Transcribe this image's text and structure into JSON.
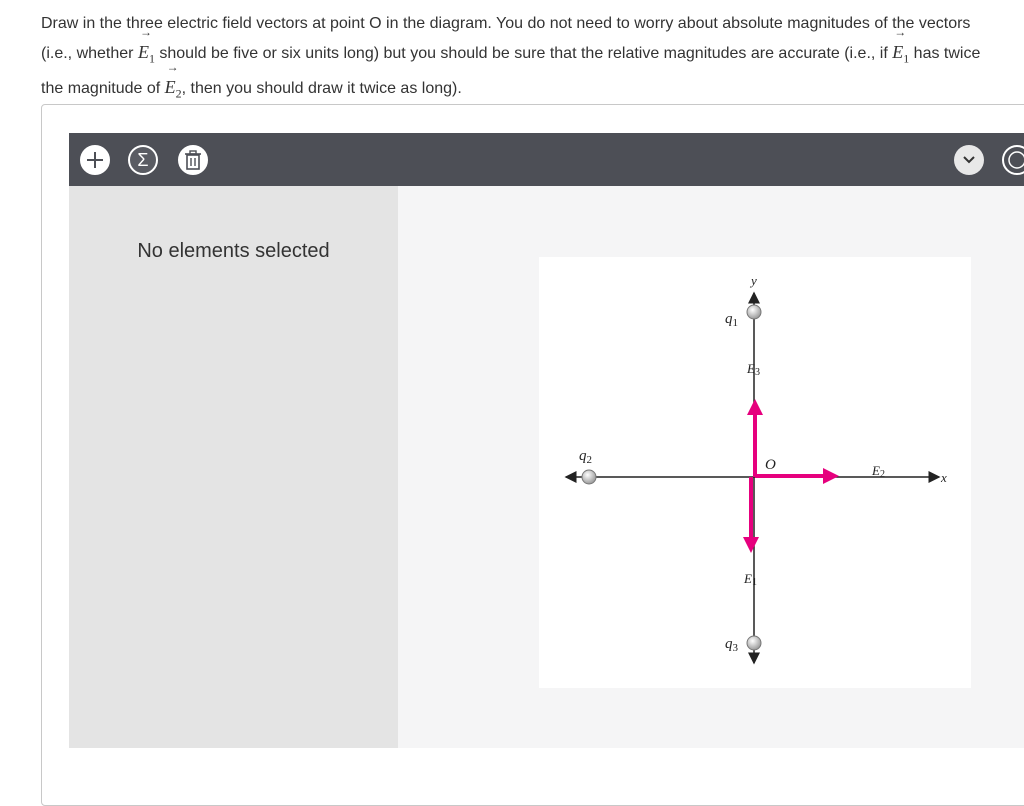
{
  "instructions": {
    "part1": "Draw in the three electric field vectors at point O in the diagram. You do not need to worry about absolute magnitudes of the vectors (i.e., whether ",
    "part2": " should be five or six units long) but you should be sure that the relative magnitudes are accurate (i.e., if ",
    "part3": " has twice the magnitude of ",
    "part4": ", then you should draw it twice as long).",
    "vec_symbol": "E",
    "vec1_sub": "1",
    "vec2_sub": "2"
  },
  "toolbar": {
    "add_icon": "plus-icon",
    "sum_icon": "sigma-icon",
    "delete_icon": "trash-icon",
    "expand_icon": "chevron-down-icon",
    "sum_glyph": "Σ"
  },
  "sidebar": {
    "message": "No elements selected"
  },
  "diagram": {
    "axis_y": "y",
    "axis_x": "x",
    "origin": "O",
    "q1": "q",
    "q1_sub": "1",
    "q2": "q",
    "q2_sub": "2",
    "q3": "q",
    "q3_sub": "3",
    "e1": "E",
    "e1_sub": "1",
    "e2": "E",
    "e2_sub": "2",
    "e3": "E",
    "e3_sub": "3",
    "vector_color": "#e6007e"
  }
}
